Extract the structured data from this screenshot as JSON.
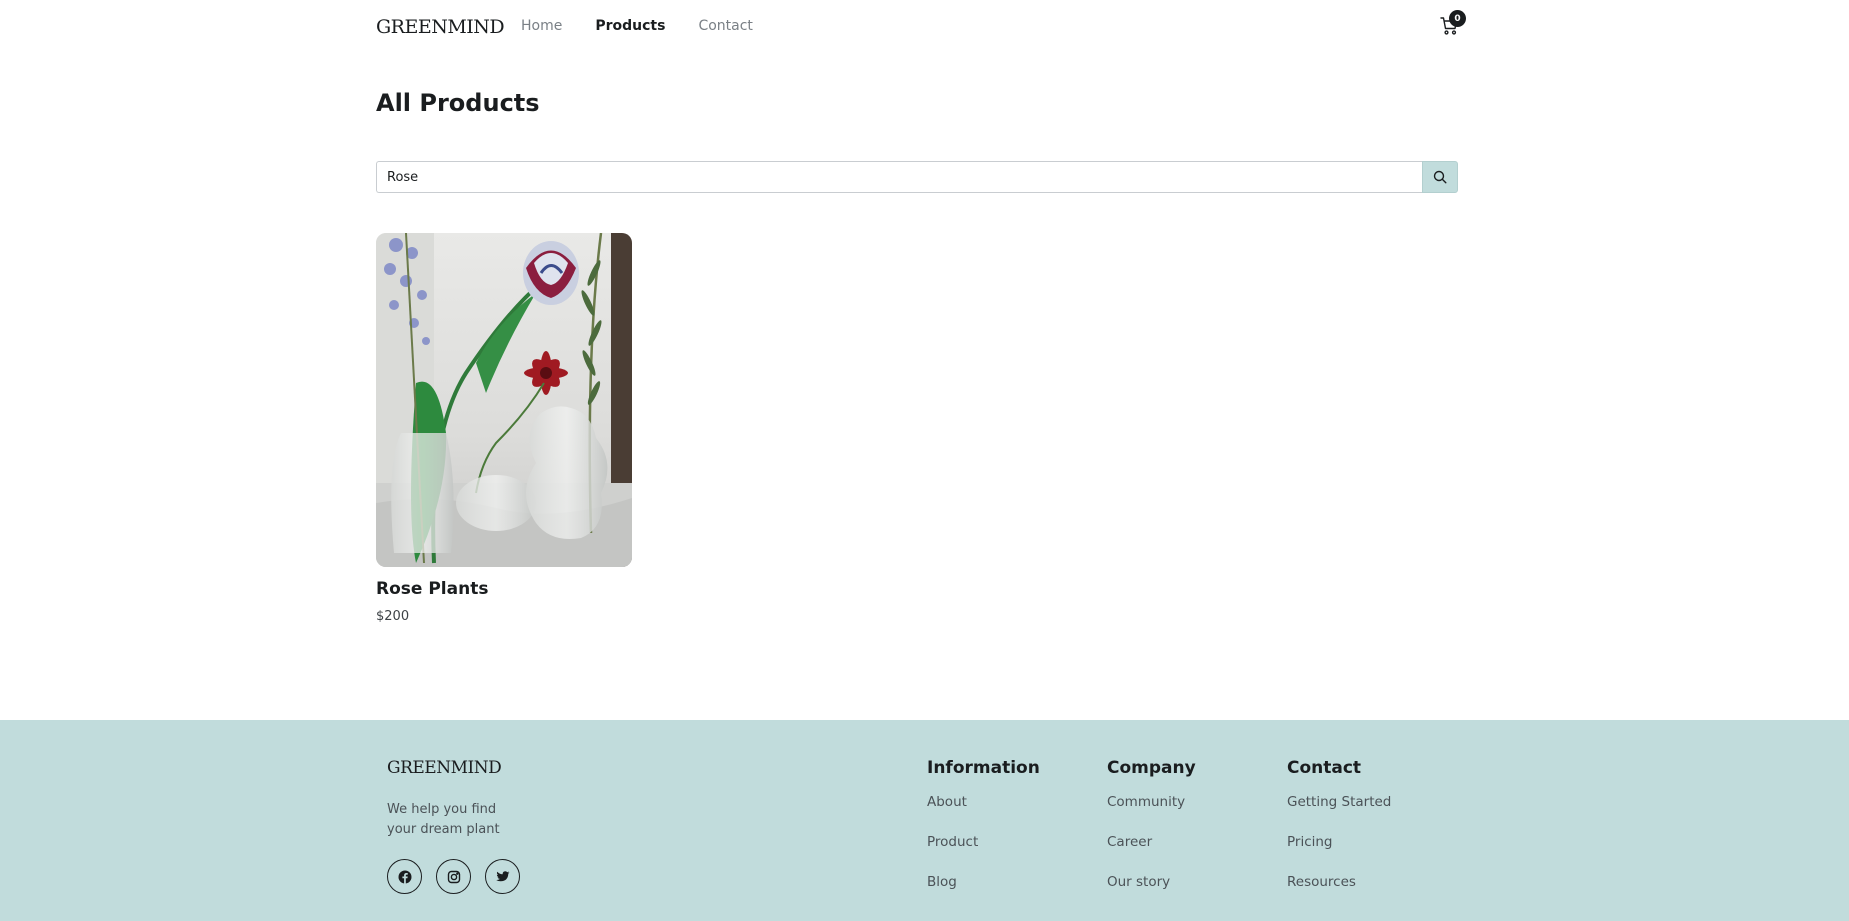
{
  "header": {
    "logo": "GREENMIND",
    "nav": [
      {
        "label": "Home",
        "active": false
      },
      {
        "label": "Products",
        "active": true
      },
      {
        "label": "Contact",
        "active": false
      }
    ],
    "cart_count": "0",
    "cart_icon": "cart-icon"
  },
  "main": {
    "title": "All Products",
    "search": {
      "value": "Rose",
      "placeholder": "",
      "button_icon": "search-icon"
    },
    "products": [
      {
        "name": "Rose Plants",
        "price": "$200",
        "image": "flowers-in-glass-vases"
      }
    ]
  },
  "footer": {
    "logo": "GREENMIND",
    "tagline": "We help you find your dream plant",
    "socials": [
      "facebook-icon",
      "instagram-icon",
      "twitter-icon"
    ],
    "columns": [
      {
        "title": "Information",
        "links": [
          "About",
          "Product",
          "Blog"
        ]
      },
      {
        "title": "Company",
        "links": [
          "Community",
          "Career",
          "Our story"
        ]
      },
      {
        "title": "Contact",
        "links": [
          "Getting Started",
          "Pricing",
          "Resources"
        ]
      }
    ]
  },
  "colors": {
    "accent": "#c1dcdc",
    "text": "#1a1d1f",
    "muted": "#7a8086"
  }
}
